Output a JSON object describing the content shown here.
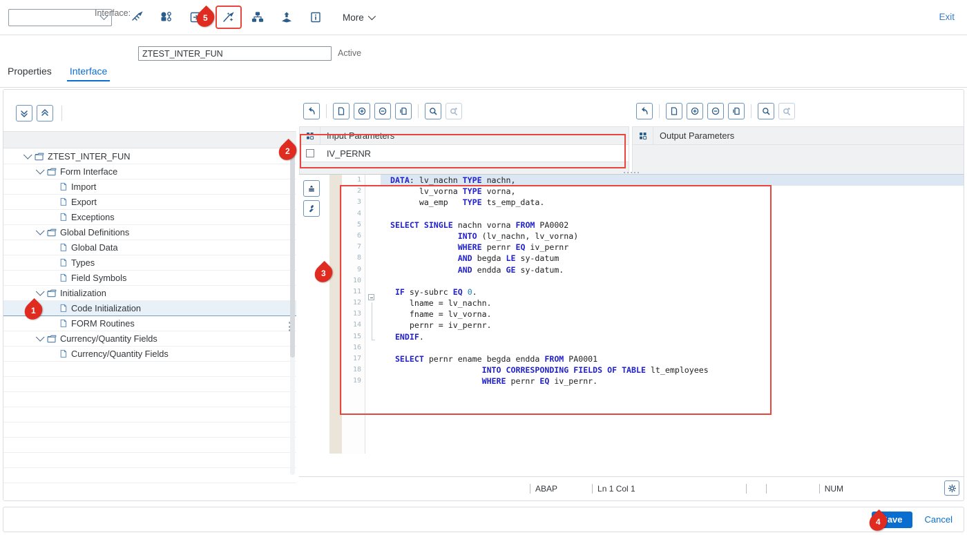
{
  "toolbar": {
    "dropdown_value": "",
    "icons": [
      {
        "name": "activate-icon",
        "glyph": "activate"
      },
      {
        "name": "where-used-icon",
        "glyph": "where-used"
      },
      {
        "name": "copy-to-icon",
        "glyph": "copy-to"
      },
      {
        "name": "pattern-wand-icon",
        "glyph": "wand"
      },
      {
        "name": "hierarchy-icon",
        "glyph": "hierarchy"
      },
      {
        "name": "import-icon",
        "glyph": "import"
      },
      {
        "name": "info-icon",
        "glyph": "info"
      }
    ],
    "more_label": "More",
    "exit_label": "Exit"
  },
  "header": {
    "interface_label": "Interface:",
    "interface_value": "ZTEST_INTER_FUN",
    "interface_placeholder": "",
    "status": "Active"
  },
  "tabs": [
    {
      "label": "Properties",
      "active": false
    },
    {
      "label": "Interface",
      "active": true
    }
  ],
  "tree": {
    "toolbar": [
      {
        "name": "expand-all-button",
        "glyph": "chevrons-down"
      },
      {
        "name": "collapse-all-button",
        "glyph": "chevrons-up"
      }
    ],
    "items": [
      {
        "label": "ZTEST_INTER_FUN",
        "depth": 0,
        "type": "folder",
        "expanded": true,
        "selected": false
      },
      {
        "label": "Form Interface",
        "depth": 1,
        "type": "folder",
        "expanded": true,
        "selected": false
      },
      {
        "label": "Import",
        "depth": 2,
        "type": "leaf",
        "expanded": false,
        "selected": false
      },
      {
        "label": "Export",
        "depth": 2,
        "type": "leaf",
        "expanded": false,
        "selected": false
      },
      {
        "label": "Exceptions",
        "depth": 2,
        "type": "leaf",
        "expanded": false,
        "selected": false
      },
      {
        "label": "Global Definitions",
        "depth": 1,
        "type": "folder",
        "expanded": true,
        "selected": false
      },
      {
        "label": "Global Data",
        "depth": 2,
        "type": "leaf",
        "expanded": false,
        "selected": false
      },
      {
        "label": "Types",
        "depth": 2,
        "type": "leaf",
        "expanded": false,
        "selected": false
      },
      {
        "label": "Field Symbols",
        "depth": 2,
        "type": "leaf",
        "expanded": false,
        "selected": false
      },
      {
        "label": "Initialization",
        "depth": 1,
        "type": "folder",
        "expanded": true,
        "selected": false
      },
      {
        "label": "Code Initialization",
        "depth": 2,
        "type": "leaf",
        "expanded": false,
        "selected": true
      },
      {
        "label": "FORM Routines",
        "depth": 2,
        "type": "leaf",
        "expanded": false,
        "selected": false
      },
      {
        "label": "Currency/Quantity Fields",
        "depth": 1,
        "type": "folder",
        "expanded": true,
        "selected": false
      },
      {
        "label": "Currency/Quantity Fields",
        "depth": 2,
        "type": "leaf",
        "expanded": false,
        "selected": false
      }
    ],
    "empty_row_count": 8
  },
  "input_parameters": {
    "toolbar": [
      {
        "name": "undo-button",
        "glyph": "undo"
      },
      {
        "name": "new-row-button",
        "glyph": "page"
      },
      {
        "name": "insert-row-button",
        "glyph": "plus-circle"
      },
      {
        "name": "delete-row-button",
        "glyph": "minus-circle"
      },
      {
        "name": "duplicate-row-button",
        "glyph": "duplicate"
      },
      {
        "name": "find-button",
        "glyph": "search"
      },
      {
        "name": "find-next-button",
        "glyph": "search-next"
      }
    ],
    "column_header": "Input Parameters",
    "rows": [
      {
        "checked": false,
        "value": "IV_PERNR"
      }
    ]
  },
  "output_parameters": {
    "toolbar": [
      {
        "name": "undo-button",
        "glyph": "undo"
      },
      {
        "name": "new-row-button",
        "glyph": "page"
      },
      {
        "name": "insert-row-button",
        "glyph": "plus-circle"
      },
      {
        "name": "delete-row-button",
        "glyph": "minus-circle"
      },
      {
        "name": "duplicate-row-button",
        "glyph": "duplicate"
      },
      {
        "name": "find-button",
        "glyph": "search"
      },
      {
        "name": "find-next-button",
        "glyph": "search-next"
      }
    ],
    "column_header": "Output Parameters",
    "rows": []
  },
  "editor": {
    "side_buttons": [
      {
        "name": "insert-pattern-button",
        "glyph": "pattern"
      },
      {
        "name": "editor-settings-button",
        "glyph": "wrench"
      }
    ],
    "lines": [
      {
        "n": 1,
        "text": "DATA: lv_nachn TYPE nachn,",
        "indent": 2
      },
      {
        "n": 2,
        "text": "lv_vorna TYPE vorna,",
        "indent": 8
      },
      {
        "n": 3,
        "text": "wa_emp   TYPE ts_emp_data.",
        "indent": 8
      },
      {
        "n": 4,
        "text": "",
        "indent": 0
      },
      {
        "n": 5,
        "text": "SELECT SINGLE nachn vorna FROM PA0002",
        "indent": 2
      },
      {
        "n": 6,
        "text": "INTO (lv_nachn, lv_vorna)",
        "indent": 16
      },
      {
        "n": 7,
        "text": "WHERE pernr EQ iv_pernr",
        "indent": 16
      },
      {
        "n": 8,
        "text": "AND begda LE sy-datum",
        "indent": 16
      },
      {
        "n": 9,
        "text": "AND endda GE sy-datum.",
        "indent": 16
      },
      {
        "n": 10,
        "text": "",
        "indent": 0
      },
      {
        "n": 11,
        "text": "IF sy-subrc EQ 0.",
        "indent": 3
      },
      {
        "n": 12,
        "text": "lname = lv_nachn.",
        "indent": 6
      },
      {
        "n": 13,
        "text": "fname = lv_vorna.",
        "indent": 6
      },
      {
        "n": 14,
        "text": "pernr = iv_pernr.",
        "indent": 6
      },
      {
        "n": 15,
        "text": "ENDIF.",
        "indent": 3
      },
      {
        "n": 16,
        "text": "",
        "indent": 0
      },
      {
        "n": 17,
        "text": "SELECT pernr ename begda endda FROM PA0001",
        "indent": 3
      },
      {
        "n": 18,
        "text": "INTO CORRESPONDING FIELDS OF TABLE lt_employees",
        "indent": 21
      },
      {
        "n": 19,
        "text": "WHERE pernr EQ iv_pernr.",
        "indent": 21
      }
    ],
    "total_rendered_lines": 25,
    "keywords": [
      "DATA:",
      "TYPE",
      "SELECT",
      "SINGLE",
      "FROM",
      "INTO",
      "WHERE",
      "AND",
      "LE",
      "GE",
      "EQ",
      "IF",
      "ENDIF.",
      "CORRESPONDING",
      "FIELDS",
      "OF",
      "TABLE"
    ],
    "status_bar": {
      "language": "ABAP",
      "position": "Ln  1 Col  1",
      "mode": "NUM",
      "settings_icon": "gear-icon"
    }
  },
  "footer": {
    "save_label": "Save",
    "cancel_label": "Cancel"
  },
  "annotations": [
    {
      "number": "1",
      "target": "tree-item-code-initialization"
    },
    {
      "number": "2",
      "target": "input-parameters-grid"
    },
    {
      "number": "3",
      "target": "code-editor-area"
    },
    {
      "number": "4",
      "target": "save-button"
    },
    {
      "number": "5",
      "target": "pattern-wand-toolbar-button"
    }
  ],
  "colors": {
    "accent": "#0a6ed1",
    "annotation_red": "#e02b20",
    "highlight_box": "#e8463c",
    "keyword_blue": "#2222cc",
    "selection_blue": "#dbe7f3"
  }
}
